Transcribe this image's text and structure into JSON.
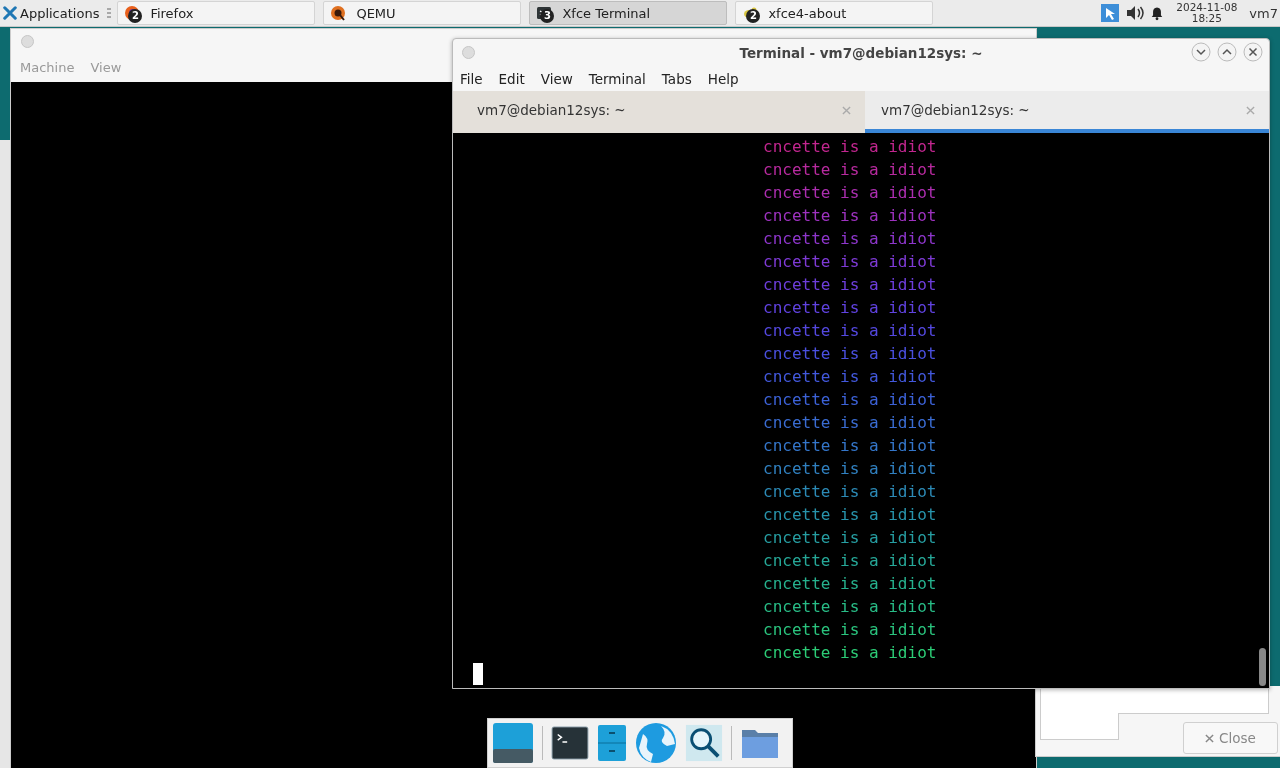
{
  "panel": {
    "applications": "Applications",
    "tasks": [
      {
        "label": "Firefox",
        "count": "2",
        "kind": "firefox",
        "selected": false
      },
      {
        "label": "QEMU",
        "kind": "qemu",
        "selected": false
      },
      {
        "label": "Xfce Terminal",
        "count": "3",
        "kind": "terminal",
        "selected": true
      },
      {
        "label": "xfce4-about",
        "count": "2",
        "kind": "about",
        "selected": false
      }
    ],
    "clock": {
      "date": "2024-11-08",
      "time": "18:25"
    },
    "user": "vm7"
  },
  "qemu_window": {
    "menu": [
      "Machine",
      "View"
    ]
  },
  "terminal": {
    "title": "Terminal - vm7@debian12sys: ~",
    "menu": [
      "File",
      "Edit",
      "View",
      "Terminal",
      "Tabs",
      "Help"
    ],
    "tabs": [
      {
        "label": "vm7@debian12sys: ~",
        "selected": false
      },
      {
        "label": "vm7@debian12sys: ~",
        "selected": true
      }
    ],
    "lines": [
      {
        "text": "cncette is a idiot",
        "color": "#c2268f"
      },
      {
        "text": "cncette is a idiot",
        "color": "#b82a9f"
      },
      {
        "text": "cncette is a idiot",
        "color": "#ac2eb0"
      },
      {
        "text": "cncette is a idiot",
        "color": "#9e32c0"
      },
      {
        "text": "cncette is a idiot",
        "color": "#8e36cc"
      },
      {
        "text": "cncette is a idiot",
        "color": "#7e3ad6"
      },
      {
        "text": "cncette is a idiot",
        "color": "#6e3edc"
      },
      {
        "text": "cncette is a idiot",
        "color": "#6042e0"
      },
      {
        "text": "cncette is a idiot",
        "color": "#5448e0"
      },
      {
        "text": "cncette is a idiot",
        "color": "#4a50e0"
      },
      {
        "text": "cncette is a idiot",
        "color": "#4258dc"
      },
      {
        "text": "cncette is a idiot",
        "color": "#3c62d8"
      },
      {
        "text": "cncette is a idiot",
        "color": "#3a6cd2"
      },
      {
        "text": "cncette is a idiot",
        "color": "#3476ca"
      },
      {
        "text": "cncette is a idiot",
        "color": "#3080c0"
      },
      {
        "text": "cncette is a idiot",
        "color": "#2c8ab6"
      },
      {
        "text": "cncette is a idiot",
        "color": "#2894ac"
      },
      {
        "text": "cncette is a idiot",
        "color": "#269ea2"
      },
      {
        "text": "cncette is a idiot",
        "color": "#26a898"
      },
      {
        "text": "cncette is a idiot",
        "color": "#26b28e"
      },
      {
        "text": "cncette is a idiot",
        "color": "#28bc86"
      },
      {
        "text": "cncette is a idiot",
        "color": "#2ac47e"
      },
      {
        "text": "cncette is a idiot",
        "color": "#2ccc76"
      }
    ]
  },
  "about_window": {
    "close_button": "Close"
  }
}
